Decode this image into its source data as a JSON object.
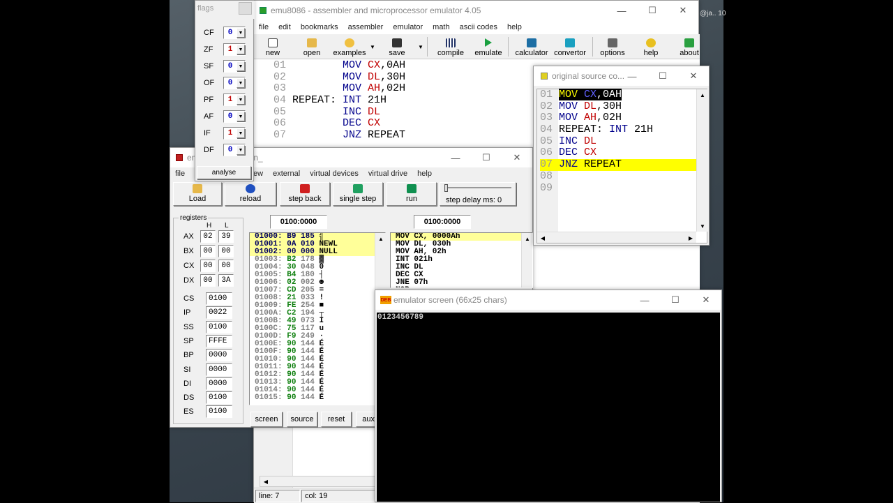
{
  "flags_window": {
    "title": "flags",
    "analyse_label": "analyse",
    "flags": [
      {
        "name": "CF",
        "value": "0"
      },
      {
        "name": "ZF",
        "value": "1"
      },
      {
        "name": "SF",
        "value": "0"
      },
      {
        "name": "OF",
        "value": "0"
      },
      {
        "name": "PF",
        "value": "1"
      },
      {
        "name": "AF",
        "value": "0"
      },
      {
        "name": "IF",
        "value": "1"
      },
      {
        "name": "DF",
        "value": "0"
      }
    ]
  },
  "main_window": {
    "title": "emu8086 - assembler and microprocessor emulator 4.05",
    "menu": [
      "file",
      "edit",
      "bookmarks",
      "assembler",
      "emulator",
      "math",
      "ascii codes",
      "help"
    ],
    "toolbar": [
      "new",
      "open",
      "examples",
      "save",
      "compile",
      "emulate",
      "calculator",
      "convertor",
      "options",
      "help",
      "about"
    ],
    "code": [
      {
        "n": "01",
        "label": "",
        "op": "MOV",
        "reg": "CX",
        "rest": ",0AH"
      },
      {
        "n": "02",
        "label": "",
        "op": "MOV",
        "reg": "DL",
        "rest": ",30H"
      },
      {
        "n": "03",
        "label": "",
        "op": "MOV",
        "reg": "AH",
        "rest": ",02H"
      },
      {
        "n": "04",
        "label": "REPEAT:",
        "op": "INT",
        "reg": "",
        "rest": "21H"
      },
      {
        "n": "05",
        "label": "",
        "op": "INC",
        "reg": "DL",
        "rest": ""
      },
      {
        "n": "06",
        "label": "",
        "op": "DEC",
        "reg": "CX",
        "rest": ""
      },
      {
        "n": "07",
        "label": "",
        "op": "JNZ",
        "reg": "",
        "rest": "REPEAT"
      }
    ],
    "status": {
      "line": "line: 7",
      "col": "col: 19"
    }
  },
  "emulator_window": {
    "title_fragment": "em",
    "title_suffix": "in_",
    "menu": [
      "file",
      "view",
      "external",
      "virtual devices",
      "virtual drive",
      "help"
    ],
    "toolbar": [
      "Load",
      "reload",
      "step back",
      "single step",
      "run"
    ],
    "step_delay": "step delay ms: 0",
    "registers_label": "registers",
    "h_label": "H",
    "l_label": "L",
    "gp_registers": [
      {
        "name": "AX",
        "h": "02",
        "l": "39"
      },
      {
        "name": "BX",
        "h": "00",
        "l": "00"
      },
      {
        "name": "CX",
        "h": "00",
        "l": "00"
      },
      {
        "name": "DX",
        "h": "00",
        "l": "3A"
      }
    ],
    "seg_registers": [
      {
        "name": "CS",
        "value": "0100"
      },
      {
        "name": "IP",
        "value": "0022"
      },
      {
        "name": "SS",
        "value": "0100"
      },
      {
        "name": "SP",
        "value": "FFFE"
      },
      {
        "name": "BP",
        "value": "0000"
      },
      {
        "name": "SI",
        "value": "0000"
      },
      {
        "name": "DI",
        "value": "0000"
      },
      {
        "name": "DS",
        "value": "0100"
      },
      {
        "name": "ES",
        "value": "0100"
      }
    ],
    "address_left": "0100:0000",
    "address_right": "0100:0000",
    "memory": [
      {
        "addr": "01000:",
        "hex": "B9",
        "dec": "185",
        "ch": "╣"
      },
      {
        "addr": "01001:",
        "hex": "0A",
        "dec": "010",
        "ch": "NEWL"
      },
      {
        "addr": "01002:",
        "hex": "00",
        "dec": "000",
        "ch": "NULL"
      },
      {
        "addr": "01003:",
        "hex": "B2",
        "dec": "178",
        "ch": "▓"
      },
      {
        "addr": "01004:",
        "hex": "30",
        "dec": "048",
        "ch": "0"
      },
      {
        "addr": "01005:",
        "hex": "B4",
        "dec": "180",
        "ch": "┤"
      },
      {
        "addr": "01006:",
        "hex": "02",
        "dec": "002",
        "ch": "☻"
      },
      {
        "addr": "01007:",
        "hex": "CD",
        "dec": "205",
        "ch": "="
      },
      {
        "addr": "01008:",
        "hex": "21",
        "dec": "033",
        "ch": "!"
      },
      {
        "addr": "01009:",
        "hex": "FE",
        "dec": "254",
        "ch": "■"
      },
      {
        "addr": "0100A:",
        "hex": "C2",
        "dec": "194",
        "ch": "┬"
      },
      {
        "addr": "0100B:",
        "hex": "49",
        "dec": "073",
        "ch": "I"
      },
      {
        "addr": "0100C:",
        "hex": "75",
        "dec": "117",
        "ch": "u"
      },
      {
        "addr": "0100D:",
        "hex": "F9",
        "dec": "249",
        "ch": "·"
      },
      {
        "addr": "0100E:",
        "hex": "90",
        "dec": "144",
        "ch": "É"
      },
      {
        "addr": "0100F:",
        "hex": "90",
        "dec": "144",
        "ch": "É"
      },
      {
        "addr": "01010:",
        "hex": "90",
        "dec": "144",
        "ch": "É"
      },
      {
        "addr": "01011:",
        "hex": "90",
        "dec": "144",
        "ch": "É"
      },
      {
        "addr": "01012:",
        "hex": "90",
        "dec": "144",
        "ch": "É"
      },
      {
        "addr": "01013:",
        "hex": "90",
        "dec": "144",
        "ch": "É"
      },
      {
        "addr": "01014:",
        "hex": "90",
        "dec": "144",
        "ch": "É"
      },
      {
        "addr": "01015:",
        "hex": "90",
        "dec": "144",
        "ch": "É"
      }
    ],
    "disasm": [
      "MOV CX, 0000Ah",
      "MOV DL, 030h",
      "MOV AH, 02h",
      "INT 021h",
      "INC DL",
      "DEC CX",
      "JNE 07h",
      "NOP"
    ],
    "bottom_buttons": [
      "screen",
      "source",
      "reset",
      "aux"
    ]
  },
  "source_window": {
    "title": "original source co...",
    "lines": [
      {
        "n": "01",
        "label": "",
        "op": "MOV",
        "reg": "CX",
        "rest": ",0AH"
      },
      {
        "n": "02",
        "label": "",
        "op": "MOV",
        "reg": "DL",
        "rest": ",30H"
      },
      {
        "n": "03",
        "label": "",
        "op": "MOV",
        "reg": "AH",
        "rest": ",02H"
      },
      {
        "n": "04",
        "label": "REPEAT:",
        "op": "INT",
        "reg": "",
        "rest": "21H"
      },
      {
        "n": "05",
        "label": "",
        "op": "INC",
        "reg": "DL",
        "rest": ""
      },
      {
        "n": "06",
        "label": "",
        "op": "DEC",
        "reg": "CX",
        "rest": ""
      },
      {
        "n": "07",
        "label": "",
        "op": "JNZ",
        "reg": "",
        "rest": "REPEAT"
      },
      {
        "n": "08",
        "label": "",
        "op": "",
        "reg": "",
        "rest": ""
      },
      {
        "n": "09",
        "label": "",
        "op": "",
        "reg": "",
        "rest": ""
      }
    ]
  },
  "screen_window": {
    "title": "emulator screen (66x25 chars)",
    "output": "0123456789",
    "icon_text": "DEB"
  },
  "desktop": {
    "corner_text": "@ja.. 10"
  }
}
